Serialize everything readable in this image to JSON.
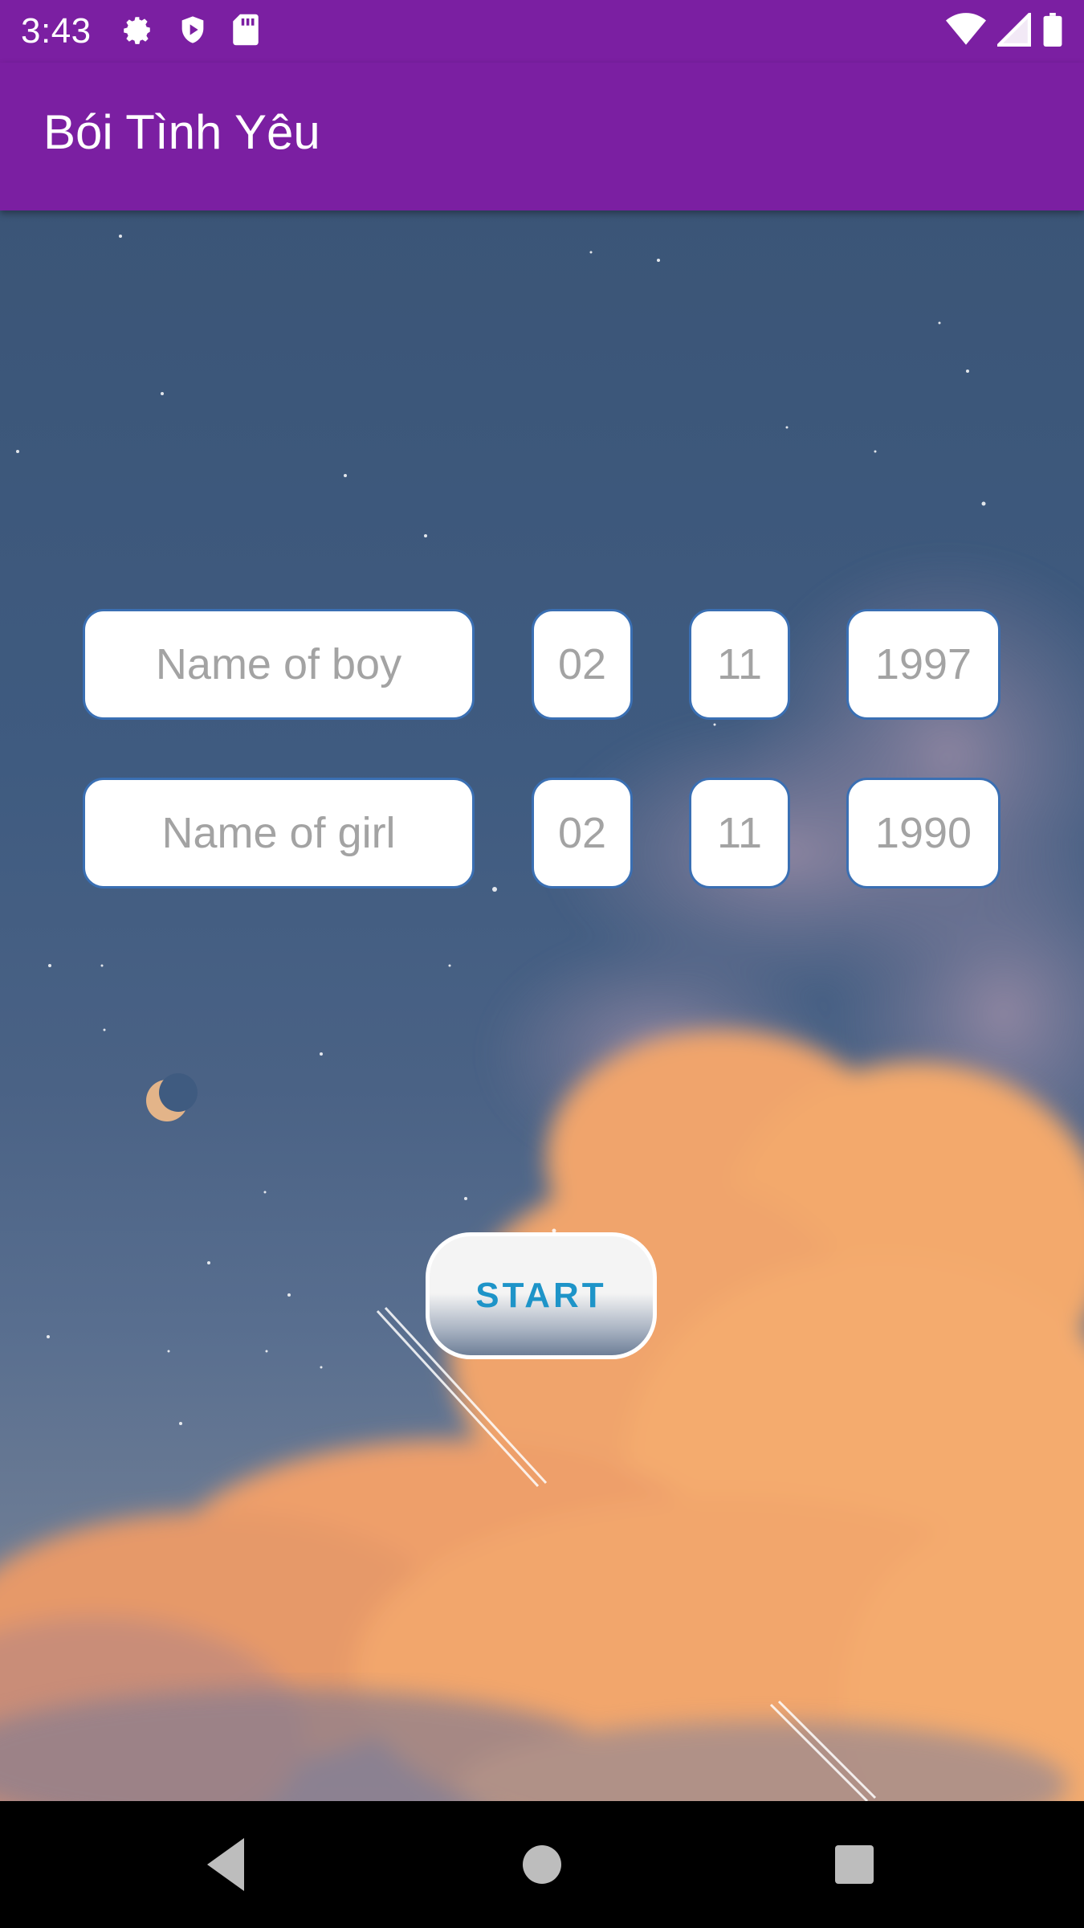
{
  "status_bar": {
    "time": "3:43",
    "left_icons": [
      "settings-icon",
      "shield-icon",
      "sd-card-icon"
    ],
    "right_icons": [
      "wifi-icon",
      "signal-icon",
      "battery-icon"
    ]
  },
  "app_bar": {
    "title": "Bói Tình Yêu",
    "color": "#7b1fa2"
  },
  "form": {
    "boy": {
      "name_placeholder": "Name of boy",
      "day": "02",
      "month": "11",
      "year": "1997"
    },
    "girl": {
      "name_placeholder": "Name of girl",
      "day": "02",
      "month": "11",
      "year": "1990"
    },
    "start_label": "START"
  },
  "nav_bar": {
    "buttons": [
      "back-icon",
      "home-icon",
      "recents-icon"
    ]
  }
}
